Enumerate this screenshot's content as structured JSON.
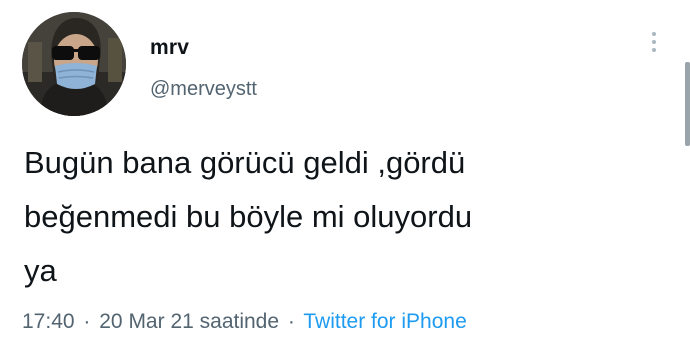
{
  "user": {
    "display_name": "mrv",
    "handle": "@merveystt",
    "avatar": "profile-photo-icon"
  },
  "tweet": {
    "text": "Bugün bana görücü geldi ,gördü\nbeğenmedi bu böyle mi oluyordu\nya",
    "time": "17:40",
    "separator1": "·",
    "date": "20 Mar 21 saatinde",
    "separator2": "·",
    "source": "Twitter for iPhone"
  },
  "icons": {
    "more": "more-vertical-icon"
  },
  "colors": {
    "text": "#0f1419",
    "secondary": "#536471",
    "link": "#1d9bf0"
  }
}
